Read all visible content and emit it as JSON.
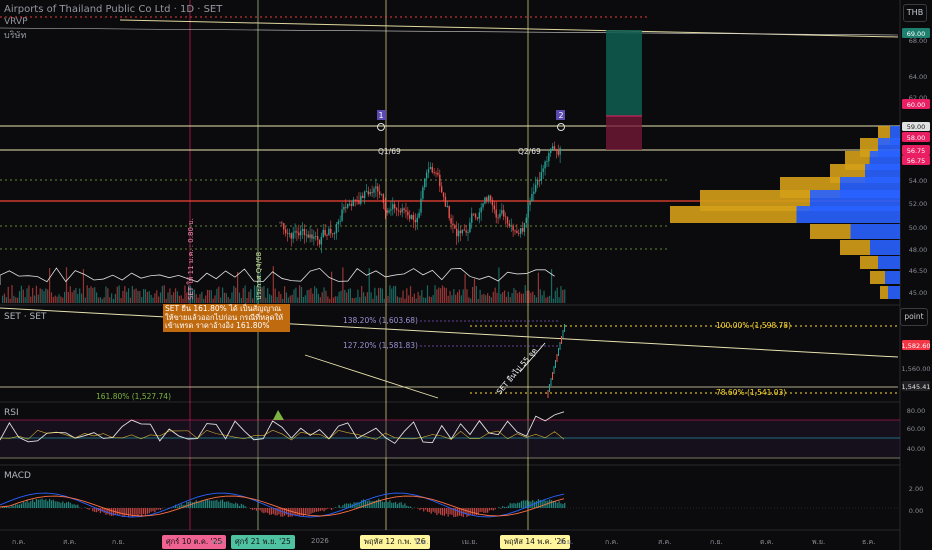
{
  "chart": {
    "title": "Airports of Thailand Public Co Ltd · 1D · SET",
    "indicator_1": "VRVP",
    "indicator_1_sub": "บริษัท",
    "currency_button": "THB",
    "point_button": "point",
    "q1_label": "Q1/69",
    "q2_label": "Q2/69",
    "marker_1": "1",
    "marker_2": "2",
    "vertical_note": "ประกาศ Q4/68",
    "vertical_note_2": "SET ให้ 11 ม.ค. : 0.80 บ."
  },
  "price_axis": {
    "ticks": [
      "68.00",
      "64.00",
      "62.00",
      "59.00",
      "58.00",
      "54.00",
      "52.00",
      "50.00",
      "48.00",
      "46.50",
      "45.00"
    ],
    "tags": [
      {
        "text": "69.00",
        "bg": "#1e7f6e",
        "fg": "#ffffff"
      },
      {
        "text": "60.00",
        "bg": "#e91e63",
        "fg": "#ffffff"
      },
      {
        "text": "58.00",
        "bg": "#e91e63",
        "fg": "#ffffff"
      },
      {
        "text": "56.75",
        "bg": "#e91e63",
        "fg": "#ffffff"
      },
      {
        "text": "56.75",
        "bg": "#e91e63",
        "fg": "#ffffff"
      }
    ]
  },
  "set_panel": {
    "name": "SET · SET",
    "fib_1382": "138.20% (1,603.68)",
    "fib_1272": "127.20% (1,581.83)",
    "fib_100": "100.00% (1,598.78)",
    "fib_786": "78.60% (1,541.03)",
    "fib_1618": "161.80% (1,527.74)",
    "arrow_label": "SET ยืนไป 55 จุด",
    "ticks": [
      "1,560.00"
    ],
    "tags": [
      {
        "text": "1,582.60",
        "bg": "#f23645",
        "fg": "#ffffff"
      },
      {
        "text": "1,545.41",
        "bg": "#222226",
        "fg": "#e0e0e0"
      }
    ],
    "note": "SET ยืน 161.80% ได้ เป็นสัญญาณให้ขายแล้วออกไปก่อน กรณีที่หลุดให้เข้าเทรด ราคาอ้างอิง 161.80%"
  },
  "rsi_panel": {
    "name": "RSI",
    "ticks": [
      "80.00",
      "60.00",
      "40.00"
    ]
  },
  "macd_panel": {
    "name": "MACD",
    "ticks": [
      "2.00",
      "0.00"
    ]
  },
  "time_axis": {
    "months": [
      "ก.ค.",
      "ส.ค.",
      "ก.ย.",
      "พ.ย.",
      "2026",
      "มี.ค.",
      "เม.ย.",
      "มิ.ย.",
      "ก.ค.",
      "ส.ค.",
      "ก.ย.",
      "ต.ค.",
      "พ.ย.",
      "ธ.ค."
    ],
    "badges": [
      {
        "text": "ศุกร์ 10 ต.ค. '25",
        "bg": "#f06292"
      },
      {
        "text": "ศุกร์ 21 พ.ย. '25",
        "bg": "#4fc3a1"
      },
      {
        "text": "พฤหัส 12 ก.พ. '26",
        "bg": "#fff59d"
      },
      {
        "text": "พฤหัส 14 พ.ค. '26",
        "bg": "#fff59d"
      }
    ]
  }
}
